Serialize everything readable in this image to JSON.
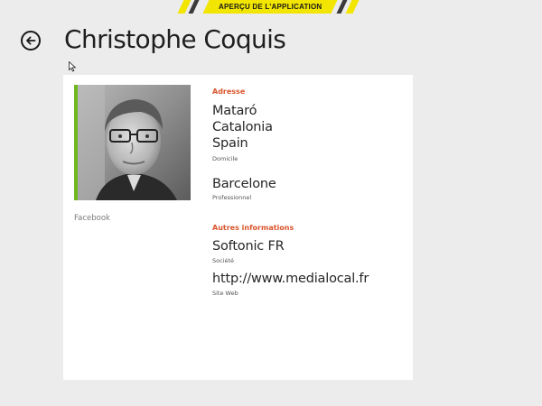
{
  "banner": {
    "label": "APERÇU DE L'APPLICATION"
  },
  "header": {
    "title": "Christophe Coquis"
  },
  "icons": {
    "back": "back-arrow-icon",
    "cursor": "mouse-pointer-icon"
  },
  "colors": {
    "accent_heading": "#d9542b",
    "photo_accent": "#6fb81e",
    "banner_yellow": "#f2e500"
  },
  "profile": {
    "source": "Facebook"
  },
  "address": {
    "heading": "Adresse",
    "home": {
      "line1": "Mataró",
      "line2": "Catalonia",
      "line3": "Spain",
      "type": "Domicile"
    },
    "work": {
      "line1": "Barcelone",
      "type": "Professionnel"
    }
  },
  "other": {
    "heading": "Autres informations",
    "company": {
      "value": "Softonic FR",
      "type": "Société"
    },
    "website": {
      "value": "http://www.medialocal.fr",
      "type": "Site Web"
    }
  }
}
